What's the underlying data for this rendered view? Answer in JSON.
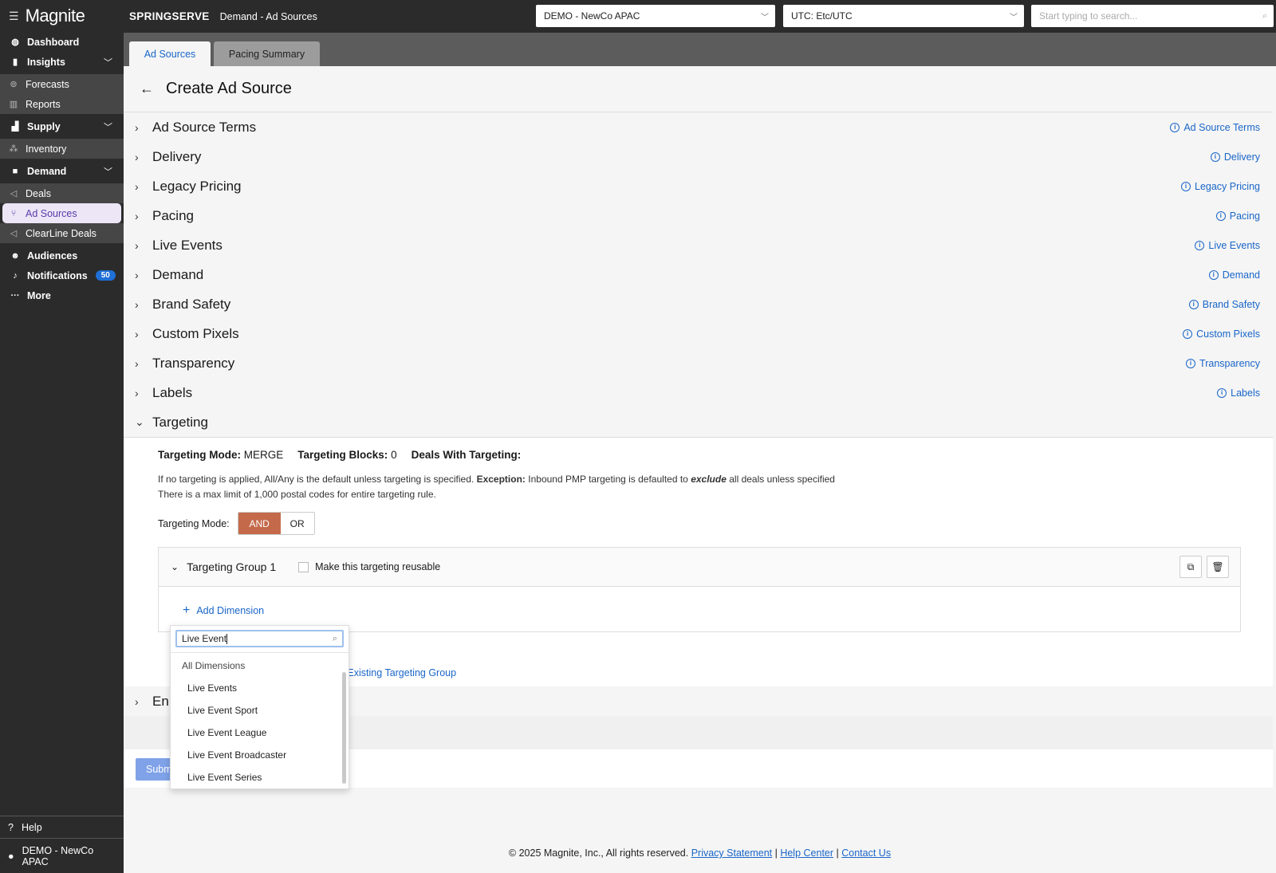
{
  "app": {
    "brand": "Magnite",
    "product": "SPRINGSERVE",
    "breadcrumb": "Demand - Ad Sources"
  },
  "topbar": {
    "org_select": "DEMO - NewCo APAC",
    "tz_select": "UTC: Etc/UTC",
    "search_placeholder": "Start typing to search..."
  },
  "sidebar": {
    "dashboard": "Dashboard",
    "insights": "Insights",
    "forecasts": "Forecasts",
    "reports": "Reports",
    "supply": "Supply",
    "inventory": "Inventory",
    "demand": "Demand",
    "deals": "Deals",
    "ad_sources": "Ad Sources",
    "clearline": "ClearLine Deals",
    "audiences": "Audiences",
    "notifications": "Notifications",
    "notifications_count": "50",
    "more": "More",
    "help": "Help",
    "account": "DEMO - NewCo APAC"
  },
  "tabs": [
    "Ad Sources",
    "Pacing Summary"
  ],
  "page_title": "Create Ad Source",
  "sections": [
    {
      "title": "Ad Source Terms",
      "help": "Ad Source Terms"
    },
    {
      "title": "Delivery",
      "help": "Delivery"
    },
    {
      "title": "Legacy Pricing",
      "help": "Legacy Pricing"
    },
    {
      "title": "Pacing",
      "help": "Pacing"
    },
    {
      "title": "Live Events",
      "help": "Live Events"
    },
    {
      "title": "Demand",
      "help": "Demand"
    },
    {
      "title": "Brand Safety",
      "help": "Brand Safety"
    },
    {
      "title": "Custom Pixels",
      "help": "Custom Pixels"
    },
    {
      "title": "Transparency",
      "help": "Transparency"
    },
    {
      "title": "Labels",
      "help": "Labels"
    },
    {
      "title": "Targeting"
    },
    {
      "title": "En"
    }
  ],
  "targeting": {
    "mode_label": "Targeting Mode:",
    "mode_value": "MERGE",
    "blocks_label": "Targeting Blocks:",
    "blocks_value": "0",
    "deals_label": "Deals With Targeting:",
    "note1_a": "If no targeting is applied, All/Any is the default unless targeting is specified. ",
    "note1_b": "Exception:",
    "note1_c": " Inbound PMP targeting is defaulted to ",
    "note1_d": "exclude",
    "note1_e": " all deals unless specified",
    "note2": "There is a max limit of 1,000 postal codes for entire targeting rule.",
    "mode_toggle_label": "Targeting Mode:",
    "and": "AND",
    "or": "OR",
    "group_name": "Targeting Group 1",
    "reusable": "Make this targeting reusable",
    "add_dimension": "Add Dimension",
    "existing_group": "d Existing Targeting Group"
  },
  "dropdown": {
    "query": "Live Event",
    "group": "All Dimensions",
    "items": [
      "Live Events",
      "Live Event Sport",
      "Live Event League",
      "Live Event Broadcaster",
      "Live Event Series"
    ]
  },
  "submit": "Submit",
  "footer": {
    "copyright": "© 2025 Magnite, Inc., All rights reserved.",
    "privacy": "Privacy Statement",
    "help": "Help Center",
    "contact": "Contact Us"
  },
  "colors": {
    "sidebar_bg": "#2b2b2b",
    "link": "#1a66c9",
    "and_active": "#c46a4b",
    "submit": "#7fa2e8"
  }
}
